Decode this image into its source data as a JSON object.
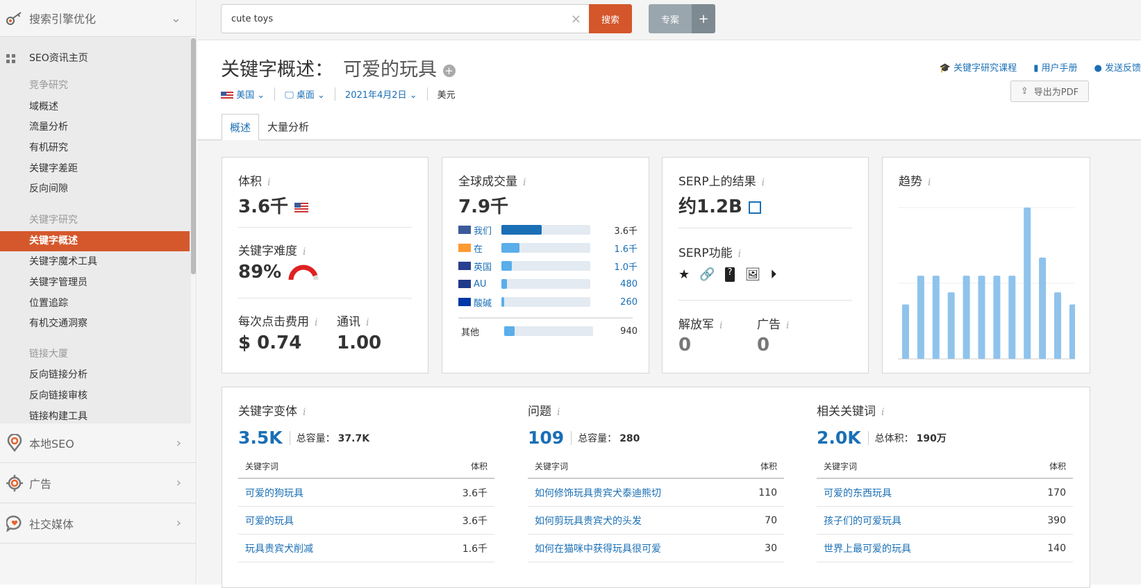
{
  "sidebar": {
    "section": "搜索引擎优化",
    "home": "SEO资讯主页",
    "groups": [
      {
        "heading": "竞争研究",
        "items": [
          "域概述",
          "流量分析",
          "有机研究",
          "关键字差距",
          "反向间隙"
        ]
      },
      {
        "heading": "关键字研究",
        "items": [
          "关键字概述",
          "关键字魔术工具",
          "关键字管理员",
          "位置追踪",
          "有机交通洞察"
        ]
      },
      {
        "heading": "链接大厦",
        "items": [
          "反向链接分析",
          "反向链接审核",
          "链接构建工具"
        ]
      }
    ],
    "sections": [
      "本地SEO",
      "广告",
      "社交媒体"
    ]
  },
  "topbar": {
    "search_value": "cute toys",
    "search_button": "搜索",
    "project_button": "专案",
    "plus": "+"
  },
  "header": {
    "title": "关键字概述：",
    "keyword": "可爱的玩具",
    "country": "美国",
    "device": "桌面",
    "date": "2021年4月2日",
    "currency": "美元",
    "links": [
      "关键字研究课程",
      "用户手册",
      "发送反馈"
    ],
    "export": "导出为PDF"
  },
  "tabs": [
    "概述",
    "大量分析"
  ],
  "volume": {
    "label": "体积",
    "value": "3.6千",
    "kd_label": "关键字难度",
    "kd_value": "89%",
    "kd_percent": 89,
    "cpc_label": "每次点击费用",
    "cpc_value": "$ 0.74",
    "com_label": "通讯",
    "com_value": "1.00"
  },
  "global": {
    "label": "全球成交量",
    "value": "7.9千",
    "countries": [
      {
        "name": "我们",
        "value": "3.6千",
        "fill": 0.45,
        "color": "#1a6fb5"
      },
      {
        "name": "在",
        "value": "1.6千",
        "fill": 0.2,
        "color": "#5aaee9"
      },
      {
        "name": "英国",
        "value": "1.0千",
        "fill": 0.12,
        "color": "#5aaee9"
      },
      {
        "name": "AU",
        "value": "480",
        "fill": 0.06,
        "color": "#5aaee9"
      },
      {
        "name": "酸碱",
        "value": "260",
        "fill": 0.03,
        "color": "#5aaee9"
      }
    ],
    "other_label": "其他",
    "other_value": "940",
    "other_fill": 0.12
  },
  "serp": {
    "label": "SERP上的结果",
    "value": "约1.2B",
    "features_label": "SERP功能",
    "features": [
      "star",
      "link",
      "question",
      "image",
      "video"
    ],
    "lib_label": "解放军",
    "lib_value": "0",
    "ads_label": "广告",
    "ads_value": "0"
  },
  "trend": {
    "label": "趋势",
    "chart_data": {
      "type": "bar",
      "values": [
        0.36,
        0.55,
        0.55,
        0.44,
        0.55,
        0.55,
        0.55,
        0.55,
        1.0,
        0.67,
        0.44,
        0.36
      ],
      "ylim": [
        0,
        1
      ]
    }
  },
  "variants": {
    "label": "关键字变体",
    "count": "3.5K",
    "total_label": "总容量：",
    "total": "37.7K",
    "col1": "关键字词",
    "col2": "体积",
    "rows": [
      [
        "可爱的狗玩具",
        "3.6千"
      ],
      [
        "可爱的玩具",
        "3.6千"
      ],
      [
        "玩具贵宾犬削减",
        "1.6千"
      ]
    ]
  },
  "questions": {
    "label": "问题",
    "count": "109",
    "total_label": "总容量：",
    "total": "280",
    "col1": "关键字词",
    "col2": "体积",
    "rows": [
      [
        "如何修饰玩具贵宾犬泰迪熊切",
        "110"
      ],
      [
        "如何剪玩具贵宾犬的头发",
        "70"
      ],
      [
        "如何在猫咪中获得玩具很可爱",
        "30"
      ]
    ]
  },
  "related": {
    "label": "相关关键词",
    "count": "2.0K",
    "total_label": "总体积：",
    "total": "190万",
    "col1": "关键字词",
    "col2": "体积",
    "rows": [
      [
        "可爱的东西玩具",
        "170"
      ],
      [
        "孩子们的可爱玩具",
        "390"
      ],
      [
        "世界上最可爱的玩具",
        "140"
      ]
    ]
  }
}
